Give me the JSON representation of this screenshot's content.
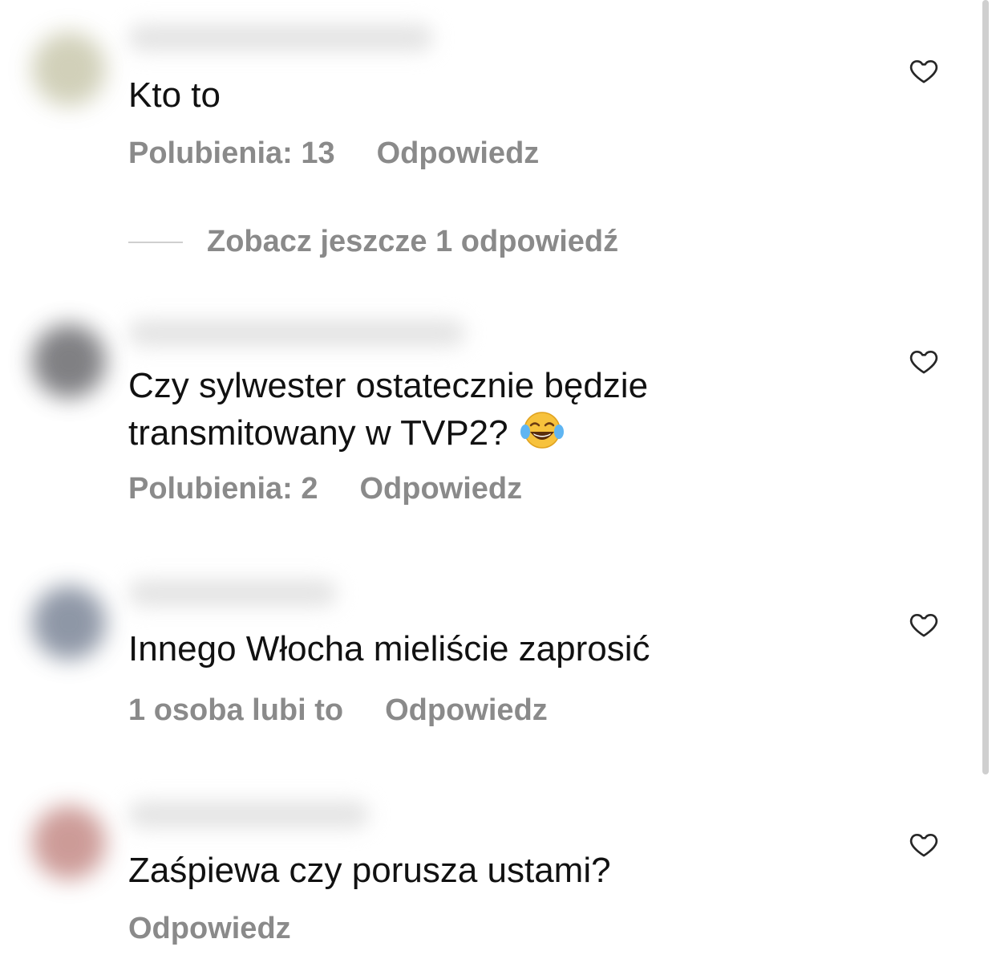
{
  "comments": [
    {
      "text": "Kto to",
      "likes_label": "Polubienia: 13",
      "reply_label": "Odpowiedz",
      "avatar_color": "#c9c8ad"
    },
    {
      "text": "Czy sylwester ostatecznie będzie\ntransmitowany w TVP2?",
      "emoji": "face-with-tears-of-joy",
      "likes_label": "Polubienia: 2",
      "reply_label": "Odpowiedz",
      "avatar_color": "#6a6a6e"
    },
    {
      "text": "Innego Włocha mieliście zaprosić",
      "likes_label": "1 osoba lubi to",
      "reply_label": "Odpowiedz",
      "avatar_color": "#7b8597"
    },
    {
      "text": "Zaśpiewa czy porusza ustami?",
      "reply_label": "Odpowiedz",
      "avatar_color": "#c48a86"
    }
  ],
  "view_replies_label": "Zobacz jeszcze 1 odpowiedź",
  "icons": {
    "like": "heart-outline-icon"
  },
  "colors": {
    "meta_text": "#8a8a8a",
    "body_text": "#111111",
    "heart_stroke": "#262626"
  }
}
